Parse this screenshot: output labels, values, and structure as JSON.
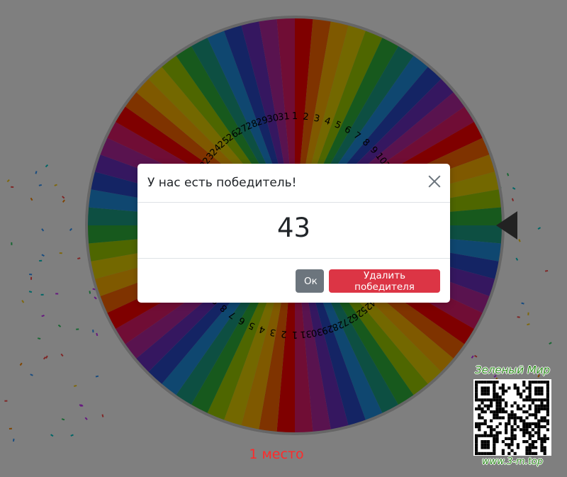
{
  "wheel": {
    "segment_colors": [
      "#ff0000",
      "#ff6600",
      "#ffb300",
      "#e6d000",
      "#9ccc00",
      "#2fb33a",
      "#1a9e84",
      "#1f8fe0",
      "#2848c8",
      "#6a2fc0",
      "#b3269e",
      "#e01a6a"
    ],
    "segment_count": 72,
    "label_count": 31,
    "pointer_icon": "triangle-pointer-icon"
  },
  "place_label": "1 место",
  "modal": {
    "title": "У нас есть победитель!",
    "winner_number": "43",
    "close_icon": "close-icon",
    "ok_label": "Ок",
    "delete_label": "Удалить победителя"
  },
  "brand": {
    "name": "Зеленый Мир",
    "url": "www.3-m.top",
    "qr_icon": "qr-code-icon",
    "color": "#2e8b1e"
  },
  "colors": {
    "overlay": "rgba(0,0,0,0.5)",
    "ok_button": "#6c757d",
    "delete_button": "#dc3545",
    "place_label": "#ff2a2a"
  }
}
